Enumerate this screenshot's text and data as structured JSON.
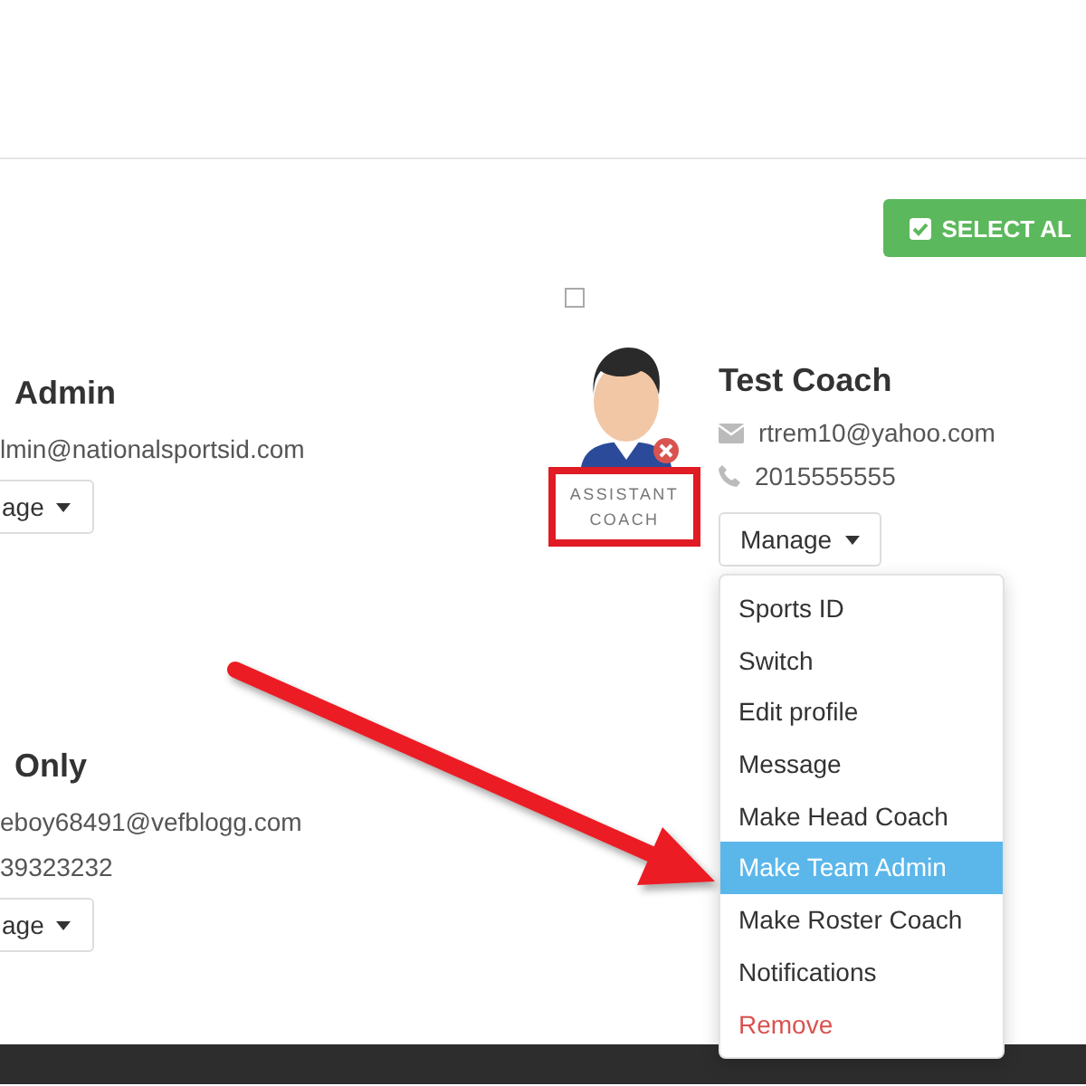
{
  "select_all_button": {
    "label": "SELECT AL"
  },
  "members": [
    {
      "name": "Admin",
      "email": "lmin@nationalsportsid.com",
      "manage_label": "age"
    },
    {
      "name": "Only",
      "email": "eboy68491@vefblogg.com",
      "phone": "39323232",
      "manage_label": "age"
    }
  ],
  "selected_member": {
    "checked": false,
    "name": "Test Coach",
    "role": "ASSISTANT COACH",
    "email": "rtrem10@yahoo.com",
    "phone": "2015555555",
    "manage_label": "Manage",
    "menu": [
      {
        "label": "Sports ID",
        "selected": false,
        "kind": "normal"
      },
      {
        "label": "Switch",
        "selected": false,
        "kind": "normal"
      },
      {
        "label": "Edit profile",
        "selected": false,
        "kind": "normal"
      },
      {
        "label": "Message",
        "selected": false,
        "kind": "normal"
      },
      {
        "label": "Make Head Coach",
        "selected": false,
        "kind": "normal"
      },
      {
        "label": "Make Team Admin",
        "selected": true,
        "kind": "normal"
      },
      {
        "label": "Make Roster Coach",
        "selected": false,
        "kind": "normal"
      },
      {
        "label": "Notifications",
        "selected": false,
        "kind": "normal"
      },
      {
        "label": "Remove",
        "selected": false,
        "kind": "danger"
      }
    ]
  }
}
